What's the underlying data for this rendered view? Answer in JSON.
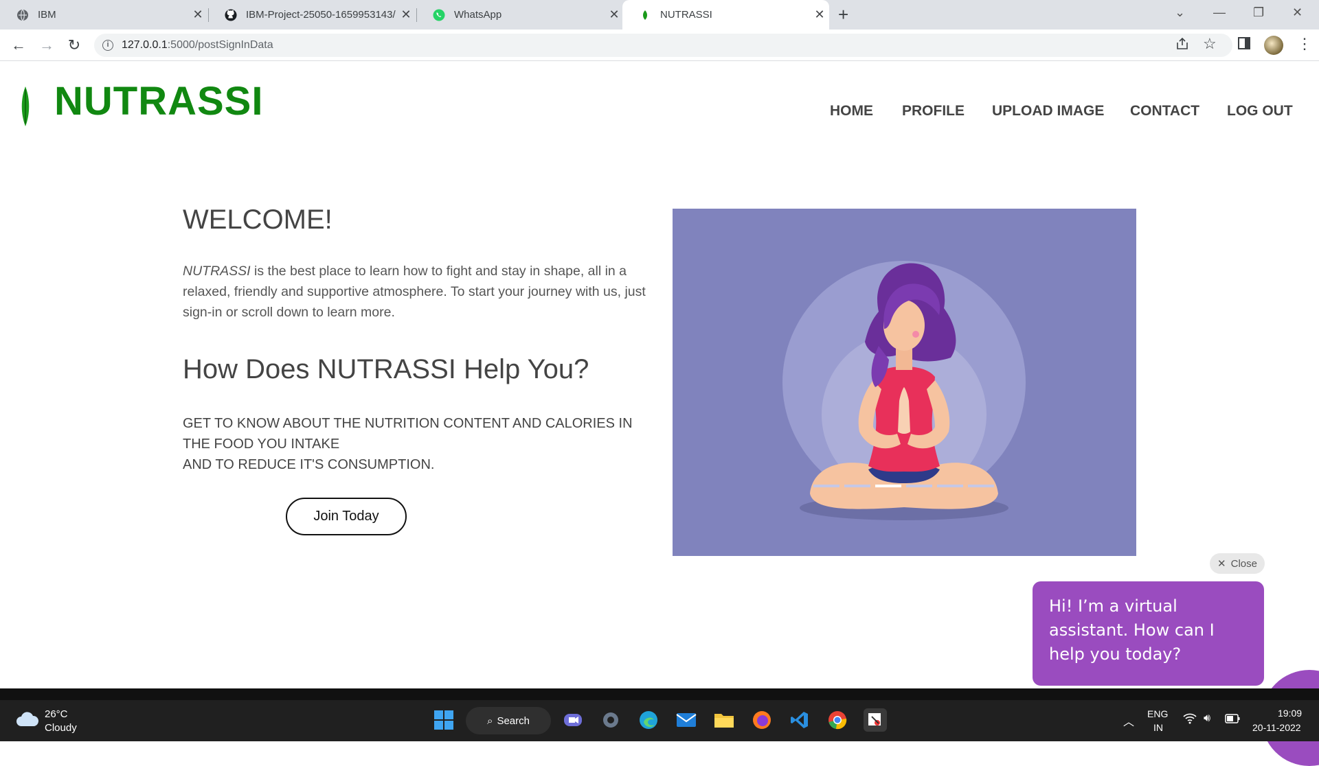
{
  "browser": {
    "tabs": [
      {
        "title": "IBM",
        "icon": "globe-icon"
      },
      {
        "title": "IBM-Project-25050-1659953143/",
        "icon": "github-icon"
      },
      {
        "title": "WhatsApp",
        "icon": "whatsapp-icon"
      },
      {
        "title": "NUTRASSI",
        "icon": "leaf-icon"
      }
    ],
    "active_tab": 3,
    "url_host": "127.0.0.1",
    "url_rest": ":5000/postSignInData"
  },
  "site": {
    "brand": "NUTRASSI",
    "brand_color": "#118811",
    "nav": [
      "HOME",
      "PROFILE",
      "UPLOAD IMAGE",
      "CONTACT",
      "LOG OUT"
    ],
    "welcome": "WELCOME!",
    "intro_em": "NUTRASSI",
    "intro_rest": " is the best place to learn how to fight and stay in shape, all in a relaxed, friendly and supportive atmosphere. To start your journey with us, just sign-in or scroll down to learn more.",
    "help_heading": "How Does NUTRASSI Help You?",
    "help_line1": "GET TO KNOW ABOUT THE NUTRITION CONTENT AND CALORIES IN THE FOOD YOU INTAKE",
    "help_line2": "AND TO REDUCE IT'S CONSUMPTION.",
    "join_button": "Join Today",
    "carousel": {
      "slides": 6,
      "active": 2,
      "bg_color": "#8083bd"
    }
  },
  "chat": {
    "close_label": "Close",
    "message": "Hi! I’m a virtual assistant. How can I help you today?",
    "color": "#9a4cbf"
  },
  "taskbar": {
    "weather_temp": "26°C",
    "weather_cond": "Cloudy",
    "search_label": "Search",
    "lang1": "ENG",
    "lang2": "IN",
    "time": "19:09",
    "date": "20-11-2022",
    "apps": [
      "windows-start-icon",
      "teams-icon",
      "settings-icon",
      "edge-icon",
      "mail-icon",
      "file-explorer-icon",
      "firefox-icon",
      "vscode-icon",
      "chrome-icon",
      "snipping-tool-icon"
    ]
  }
}
